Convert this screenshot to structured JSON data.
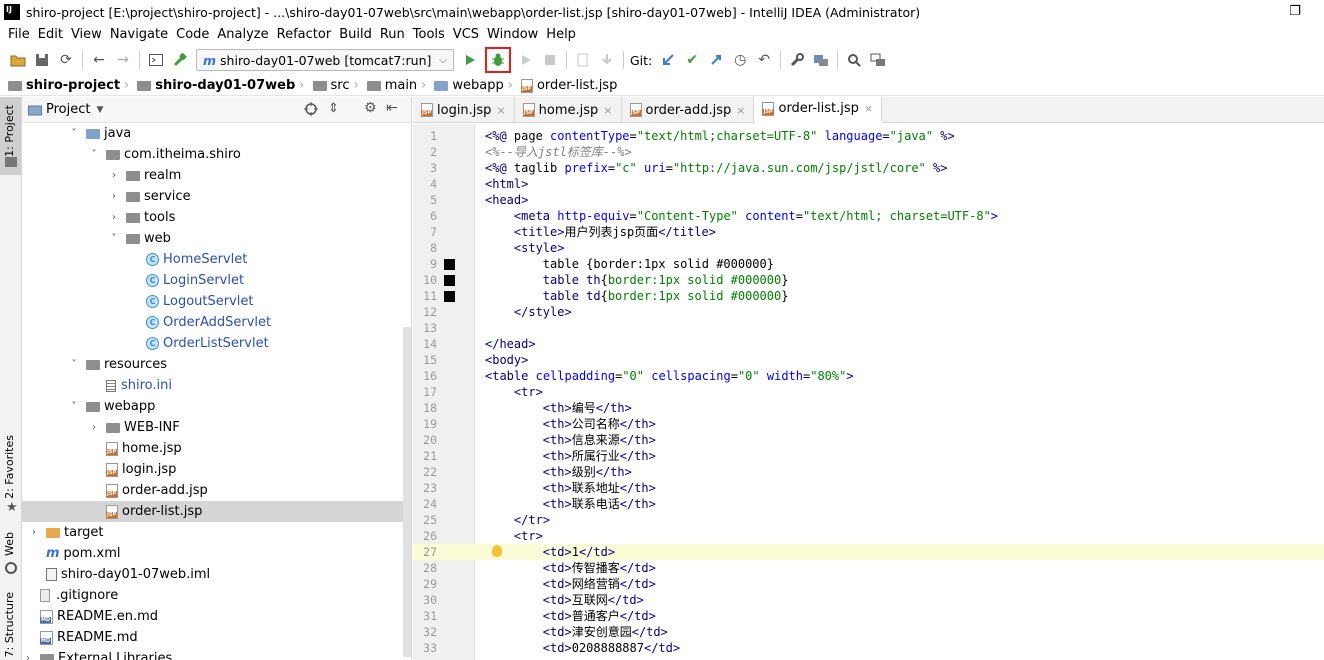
{
  "window": {
    "title": "shiro-project [E:\\project\\shiro-project] - ...\\shiro-day01-07web\\src\\main\\webapp\\order-list.jsp [shiro-day01-07web] - IntelliJ IDEA (Administrator)",
    "logo": "IJ",
    "restore_icon": "❐"
  },
  "menu": [
    "File",
    "Edit",
    "View",
    "Navigate",
    "Code",
    "Analyze",
    "Refactor",
    "Build",
    "Run",
    "Tools",
    "VCS",
    "Window",
    "Help"
  ],
  "toolbar": {
    "run_config": "shiro-day01-07web [tomcat7:run]",
    "git_label": "Git:",
    "icons": {
      "save": "⬛",
      "sync": "⟳",
      "back": "←",
      "forward": "→",
      "run": "▶",
      "debug": "✱",
      "stop": "■",
      "commit": "✔",
      "history": "◷",
      "revert": "↶",
      "settings": "🔧",
      "search": "🔍"
    },
    "accent_debug_box": "#e0201b",
    "accent_run": "#3e9b3e"
  },
  "breadcrumb": [
    "shiro-project",
    "shiro-day01-07web",
    "src",
    "main",
    "webapp",
    "order-list.jsp"
  ],
  "left_strip": {
    "project": "1: Project",
    "favorites": "2: Favorites",
    "web": "Web",
    "structure": "7: Structure"
  },
  "project_panel": {
    "title": "Project",
    "tree": [
      {
        "label": "java",
        "level": 4,
        "arrow": "⌄",
        "icon": "folder-blue"
      },
      {
        "label": "com.itheima.shiro",
        "level": 5,
        "arrow": "⌄",
        "icon": "folder"
      },
      {
        "label": "realm",
        "level": 6,
        "arrow": "›",
        "icon": "folder"
      },
      {
        "label": "service",
        "level": 6,
        "arrow": "›",
        "icon": "folder"
      },
      {
        "label": "tools",
        "level": 6,
        "arrow": "›",
        "icon": "folder"
      },
      {
        "label": "web",
        "level": 6,
        "arrow": "⌄",
        "icon": "folder"
      },
      {
        "label": "HomeServlet",
        "level": 7,
        "arrow": "",
        "icon": "class"
      },
      {
        "label": "LoginServlet",
        "level": 7,
        "arrow": "",
        "icon": "class"
      },
      {
        "label": "LogoutServlet",
        "level": 7,
        "arrow": "",
        "icon": "class"
      },
      {
        "label": "OrderAddServlet",
        "level": 7,
        "arrow": "",
        "icon": "class"
      },
      {
        "label": "OrderListServlet",
        "level": 7,
        "arrow": "",
        "icon": "class"
      },
      {
        "label": "resources",
        "level": 4,
        "arrow": "⌄",
        "icon": "folder"
      },
      {
        "label": "shiro.ini",
        "level": 5,
        "arrow": "",
        "icon": "ini"
      },
      {
        "label": "webapp",
        "level": 4,
        "arrow": "⌄",
        "icon": "folder"
      },
      {
        "label": "WEB-INF",
        "level": 5,
        "arrow": "›",
        "icon": "folder"
      },
      {
        "label": "home.jsp",
        "level": 5,
        "arrow": "",
        "icon": "jsp"
      },
      {
        "label": "login.jsp",
        "level": 5,
        "arrow": "",
        "icon": "jsp"
      },
      {
        "label": "order-add.jsp",
        "level": 5,
        "arrow": "",
        "icon": "jsp"
      },
      {
        "label": "order-list.jsp",
        "level": 5,
        "arrow": "",
        "icon": "jsp",
        "selected": true
      },
      {
        "label": "target",
        "level": 2,
        "arrow": "›",
        "icon": "folder-orange"
      },
      {
        "label": "pom.xml",
        "level": 2,
        "arrow": "",
        "icon": "maven"
      },
      {
        "label": "shiro-day01-07web.iml",
        "level": 2,
        "arrow": "",
        "icon": "iml"
      },
      {
        "label": ".gitignore",
        "level": 1,
        "arrow": "",
        "icon": "git"
      },
      {
        "label": "README.en.md",
        "level": 1,
        "arrow": "",
        "icon": "md"
      },
      {
        "label": "README.md",
        "level": 1,
        "arrow": "",
        "icon": "md"
      },
      {
        "label": "External Libraries",
        "level": 0,
        "arrow": "›",
        "icon": "lib"
      }
    ]
  },
  "tabs": [
    {
      "label": "login.jsp",
      "active": false
    },
    {
      "label": "home.jsp",
      "active": false
    },
    {
      "label": "order-add.jsp",
      "active": false
    },
    {
      "label": "order-list.jsp",
      "active": true
    }
  ],
  "editor": {
    "current_line": 27,
    "lines": [
      {
        "n": "1",
        "code": "<%@ page contentType=\"text/html;charset=UTF-8\" language=\"java\" %>"
      },
      {
        "n": "2",
        "code": "<%--导入jstl标签库--%>"
      },
      {
        "n": "3",
        "code": "<%@ taglib prefix=\"c\" uri=\"http://java.sun.com/jsp/jstl/core\" %>"
      },
      {
        "n": "4",
        "code": "<html>"
      },
      {
        "n": "5",
        "code": "<head>"
      },
      {
        "n": "6",
        "code": "    <meta http-equiv=\"Content-Type\" content=\"text/html; charset=UTF-8\">"
      },
      {
        "n": "7",
        "code": "    <title>用户列表jsp页面</title>"
      },
      {
        "n": "8",
        "code": "    <style>"
      },
      {
        "n": "9",
        "code": "        table {border:1px solid #000000}"
      },
      {
        "n": "10",
        "code": "        table th{border:1px solid #000000}"
      },
      {
        "n": "11",
        "code": "        table td{border:1px solid #000000}"
      },
      {
        "n": "12",
        "code": "    </style>"
      },
      {
        "n": "13",
        "code": ""
      },
      {
        "n": "14",
        "code": "</head>"
      },
      {
        "n": "15",
        "code": "<body>"
      },
      {
        "n": "16",
        "code": "<table cellpadding=\"0\" cellspacing=\"0\" width=\"80%\">"
      },
      {
        "n": "17",
        "code": "    <tr>"
      },
      {
        "n": "18",
        "code": "        <th>编号</th>"
      },
      {
        "n": "19",
        "code": "        <th>公司名称</th>"
      },
      {
        "n": "20",
        "code": "        <th>信息来源</th>"
      },
      {
        "n": "21",
        "code": "        <th>所属行业</th>"
      },
      {
        "n": "22",
        "code": "        <th>级别</th>"
      },
      {
        "n": "23",
        "code": "        <th>联系地址</th>"
      },
      {
        "n": "24",
        "code": "        <th>联系电话</th>"
      },
      {
        "n": "25",
        "code": "    </tr>"
      },
      {
        "n": "26",
        "code": "    <tr>"
      },
      {
        "n": "27",
        "code": "        <td>1</td>"
      },
      {
        "n": "28",
        "code": "        <td>传智播客</td>"
      },
      {
        "n": "29",
        "code": "        <td>网络营销</td>"
      },
      {
        "n": "30",
        "code": "        <td>互联网</td>"
      },
      {
        "n": "31",
        "code": "        <td>普通客户</td>"
      },
      {
        "n": "32",
        "code": "        <td>津安创意园</td>"
      },
      {
        "n": "33",
        "code": "        <td>0208888887</td>"
      }
    ]
  },
  "browser_icons": [
    {
      "name": "chrome-icon",
      "color": "#db4437"
    },
    {
      "name": "firefox-icon",
      "color": "#e66000"
    },
    {
      "name": "safari-icon",
      "color": "#1e88e5"
    },
    {
      "name": "opera-icon",
      "color": "#cc0f16"
    },
    {
      "name": "ie-icon",
      "color": "#7ec8e3"
    },
    {
      "name": "edge-icon",
      "color": "#2b74c7"
    }
  ]
}
